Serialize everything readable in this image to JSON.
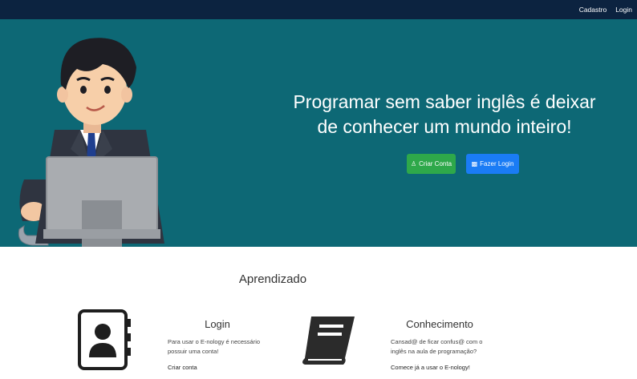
{
  "navbar": {
    "links": [
      {
        "label": "Cadastro"
      },
      {
        "label": "Login"
      }
    ]
  },
  "hero": {
    "headline_line1": "Programar sem saber inglês é deixar",
    "headline_line2": "de conhecer um mundo inteiro!",
    "buttons": [
      {
        "label": "Criar Conta",
        "icon": "person-icon",
        "color": "#2ea84a"
      },
      {
        "label": "Fazer Login",
        "icon": "monitor-icon",
        "color": "#1a7cf5"
      }
    ],
    "background": "#0d6875"
  },
  "section": {
    "title": "Aprendizado"
  },
  "features": [
    {
      "icon": "contact-book-icon",
      "title": "Login",
      "text_line1": "Para usar o E-nology é necessário",
      "text_line2": "possuir uma conta!",
      "link": "Criar conta"
    },
    {
      "icon": "book-icon",
      "title": "Conhecimento",
      "text_line1": "Cansad@ de ficar confus@ com o",
      "text_line2": "inglês na aula de programação?",
      "link": "Comece já a usar o E-nology!"
    }
  ],
  "colors": {
    "navbar": "#0c2340",
    "hero": "#0d6875",
    "green_button": "#2ea84a",
    "blue_button": "#1a7cf5"
  }
}
